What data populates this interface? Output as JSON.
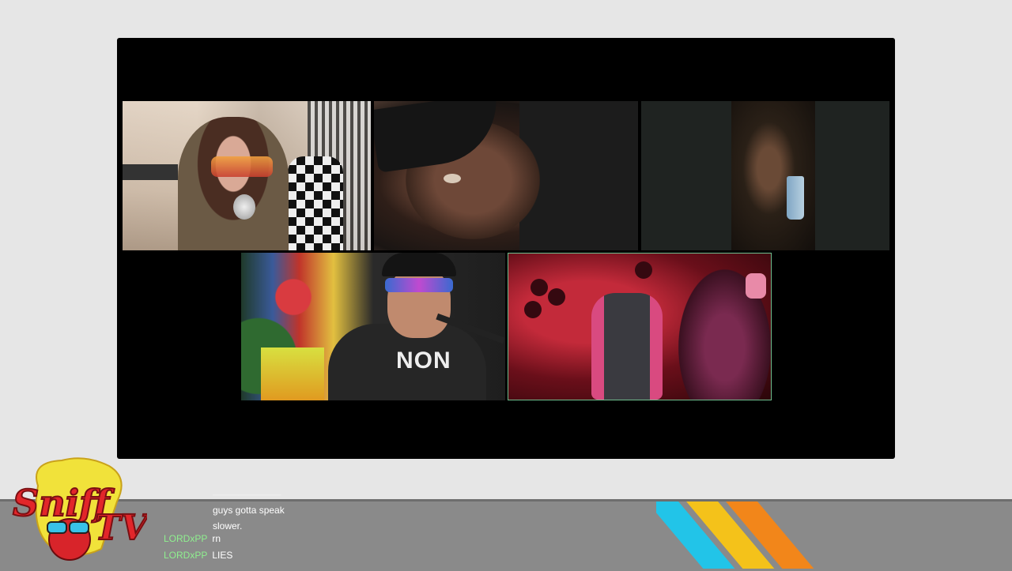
{
  "stream": {
    "participants": [
      {
        "id": "participant-1"
      },
      {
        "id": "participant-2"
      },
      {
        "id": "participant-3"
      },
      {
        "id": "participant-4",
        "shirt_text": "NON"
      },
      {
        "id": "participant-5"
      }
    ]
  },
  "branding": {
    "logo_text_top": "Sniff",
    "logo_text_bottom": "TV",
    "stripe_colors": [
      "#22c4e8",
      "#f4c21a",
      "#f2861a"
    ]
  },
  "chat": {
    "username_color": "#8ff08f",
    "continued_message_line1": "guys gotta speak",
    "continued_message_line2": "slower.",
    "messages": [
      {
        "user": "LORDxPP",
        "text": "rn"
      },
      {
        "user": "LORDxPP",
        "text": "LIES"
      }
    ]
  }
}
